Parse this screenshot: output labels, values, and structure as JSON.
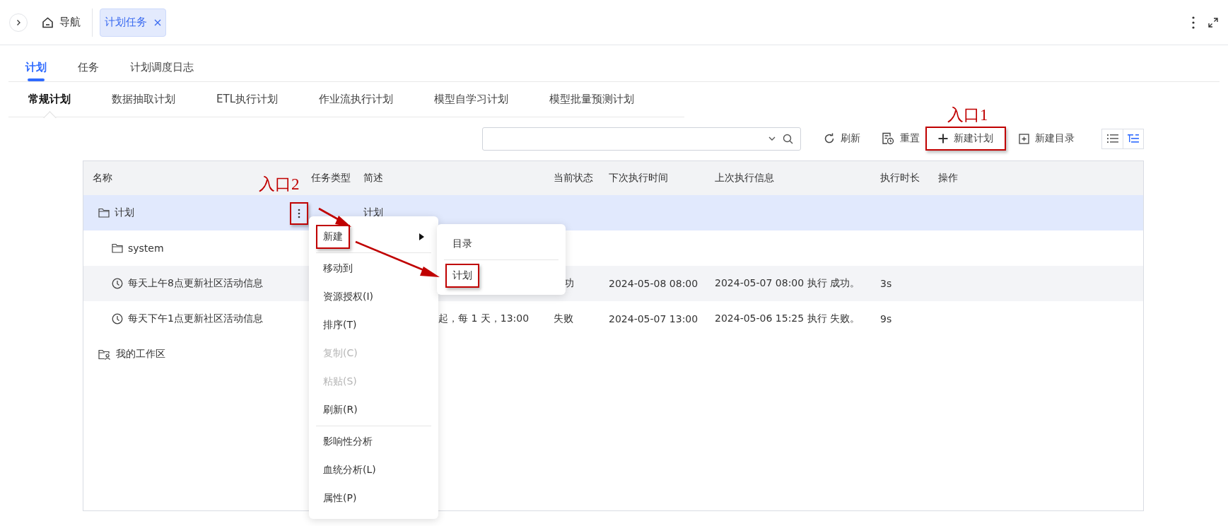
{
  "topbar": {
    "nav_label": "导航",
    "tabs": [
      {
        "label": "计划任务",
        "selected": true
      }
    ]
  },
  "tabs": [
    {
      "label": "计划",
      "selected": true
    },
    {
      "label": "任务",
      "selected": false
    },
    {
      "label": "计划调度日志",
      "selected": false
    }
  ],
  "subtabs": [
    {
      "label": "常规计划",
      "selected": true
    },
    {
      "label": "数据抽取计划",
      "selected": false
    },
    {
      "label": "ETL执行计划",
      "selected": false
    },
    {
      "label": "作业流执行计划",
      "selected": false
    },
    {
      "label": "模型自学习计划",
      "selected": false
    },
    {
      "label": "模型批量预测计划",
      "selected": false
    }
  ],
  "toolbar": {
    "buttons": [
      {
        "label": "刷新",
        "kind": "refresh",
        "annotated": false
      },
      {
        "label": "重置",
        "kind": "reset",
        "annotated": false
      },
      {
        "label": "新建计划",
        "kind": "add",
        "annotated": true
      },
      {
        "label": "新建目录",
        "kind": "add-folder",
        "annotated": false
      }
    ],
    "view_modes": [
      {
        "kind": "list",
        "selected": false
      },
      {
        "kind": "tree",
        "selected": true
      }
    ]
  },
  "table": {
    "columns": [
      "名称",
      "任务类型",
      "简述",
      "当前状态",
      "下次执行时间",
      "上次执行信息",
      "执行时长",
      "操作"
    ],
    "more_button": {
      "annotated": true
    },
    "rows": [
      {
        "name": "计划",
        "kind": "folder",
        "selected": true,
        "hovered": false,
        "description": "计划",
        "children": [
          {
            "name": "system",
            "kind": "folder",
            "selected": false,
            "hovered": false
          },
          {
            "name": "每天上午8点更新社区活动信息",
            "kind": "plan",
            "selected": false,
            "hovered": true,
            "status": "功",
            "status_cut": true,
            "next_run": "2024-05-08 08:00",
            "last_run": "2024-05-07 08:00 执行 成功。",
            "duration": "3s"
          },
          {
            "name": "每天下午1点更新社区活动信息",
            "kind": "plan",
            "selected": false,
            "hovered": false,
            "description": "起，每 1 天，13:00",
            "description_cut": true,
            "status": "失败",
            "status_cut": false,
            "next_run": "2024-05-07 13:00",
            "last_run": "2024-05-06 15:25 执行 失败。",
            "duration": "9s"
          }
        ]
      },
      {
        "name": "我的工作区",
        "kind": "workspace",
        "selected": false,
        "hovered": false
      }
    ]
  },
  "context_menu": {
    "groups": [
      [
        {
          "label": "新建",
          "disabled": false,
          "submenu": true,
          "annotated": true
        }
      ],
      [
        {
          "label": "移动到",
          "disabled": false,
          "submenu": false,
          "annotated": false
        },
        {
          "label": "资源授权(I)",
          "disabled": false,
          "submenu": false,
          "annotated": false
        },
        {
          "label": "排序(T)",
          "disabled": false,
          "submenu": false,
          "annotated": false
        },
        {
          "label": "复制(C)",
          "disabled": true,
          "submenu": false,
          "annotated": false
        },
        {
          "label": "粘贴(S)",
          "disabled": true,
          "submenu": false,
          "annotated": false
        },
        {
          "label": "刷新(R)",
          "disabled": false,
          "submenu": false,
          "annotated": false
        }
      ],
      [
        {
          "label": "影响性分析",
          "disabled": false,
          "submenu": false,
          "annotated": false
        },
        {
          "label": "血统分析(L)",
          "disabled": false,
          "submenu": false,
          "annotated": false
        },
        {
          "label": "属性(P)",
          "disabled": false,
          "submenu": false,
          "annotated": false
        }
      ]
    ]
  },
  "submenu": {
    "items": [
      {
        "label": "目录",
        "annotated": false
      },
      {
        "label": "计划",
        "annotated": true
      }
    ]
  },
  "annotations": [
    {
      "text": "入口1"
    },
    {
      "text": "入口2"
    }
  ]
}
